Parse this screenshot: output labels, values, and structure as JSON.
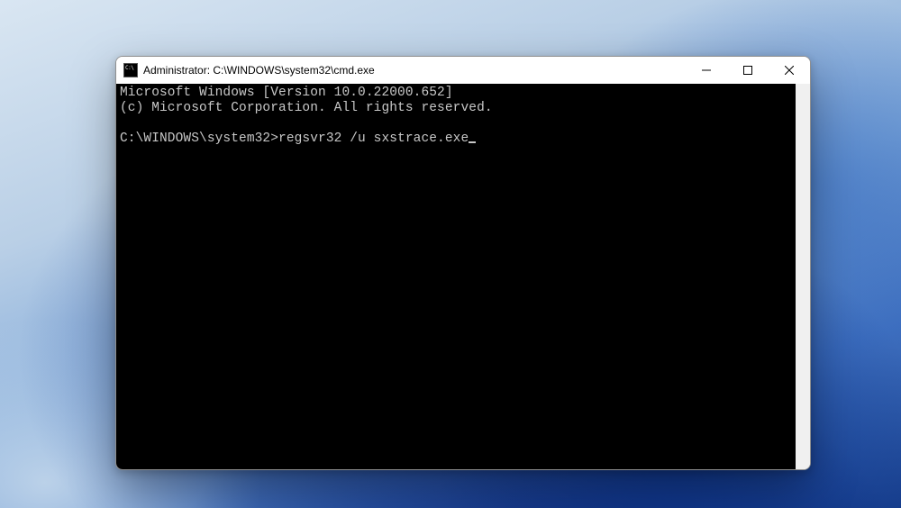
{
  "window": {
    "title": "Administrator: C:\\WINDOWS\\system32\\cmd.exe"
  },
  "terminal": {
    "banner_line1": "Microsoft Windows [Version 10.0.22000.652]",
    "banner_line2": "(c) Microsoft Corporation. All rights reserved.",
    "prompt": "C:\\WINDOWS\\system32>",
    "command": "regsvr32 /u sxstrace.exe"
  },
  "colors": {
    "terminal_bg": "#000000",
    "terminal_fg": "#c7c7c7",
    "titlebar_bg": "#ffffff"
  }
}
